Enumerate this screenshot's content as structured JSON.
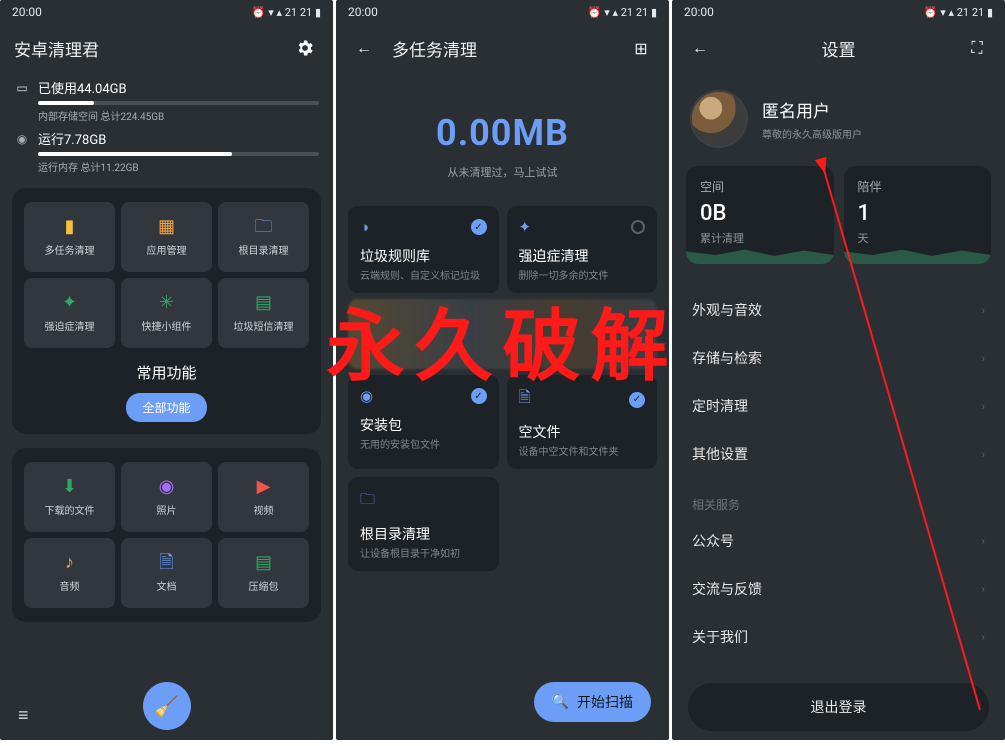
{
  "status_time": "20:00",
  "screen1": {
    "title": "安卓清理君",
    "storage_used": "已使用44.04GB",
    "storage_total": "内部存储空间 总计224.45GB",
    "mem_used": "运行7.78GB",
    "mem_total": "运行内存 总计11.22GB",
    "grid": [
      {
        "label": "多任务清理"
      },
      {
        "label": "应用管理"
      },
      {
        "label": "根目录清理"
      },
      {
        "label": "强迫症清理"
      },
      {
        "label": "快捷小组件"
      },
      {
        "label": "垃圾短信清理"
      }
    ],
    "section_label": "常用功能",
    "all_btn": "全部功能",
    "grid2": [
      {
        "label": "下载的文件"
      },
      {
        "label": "照片"
      },
      {
        "label": "视频"
      },
      {
        "label": "音频"
      },
      {
        "label": "文档"
      },
      {
        "label": "压缩包"
      }
    ]
  },
  "screen2": {
    "title": "多任务清理",
    "big_value": "0.00MB",
    "big_sub": "从未清理过，马上试试",
    "cards": [
      {
        "title": "垃圾规则库",
        "desc": "云端规则、自定义标记垃圾",
        "checked": true
      },
      {
        "title": "强迫症清理",
        "desc": "删除一切多余的文件",
        "checked": false
      },
      {
        "title": "安装包",
        "desc": "无用的安装包文件",
        "checked": true
      },
      {
        "title": "空文件",
        "desc": "设备中空文件和文件夹",
        "checked": true
      }
    ],
    "root_card": {
      "title": "根目录清理",
      "desc": "让设备根目录干净如初"
    },
    "scan_label": "开始扫描"
  },
  "screen3": {
    "title": "设置",
    "username": "匿名用户",
    "usertag": "尊敬的永久高级版用户",
    "stat1": {
      "label": "空间",
      "val": "0B",
      "sub": "累计清理"
    },
    "stat2": {
      "label": "陪伴",
      "val": "1",
      "sub": "天"
    },
    "items1": [
      "外观与音效",
      "存储与检索",
      "定时清理",
      "其他设置"
    ],
    "group2_label": "相关服务",
    "items2": [
      "公众号",
      "交流与反馈",
      "关于我们"
    ],
    "logout": "退出登录"
  },
  "overlay": "永久破解"
}
